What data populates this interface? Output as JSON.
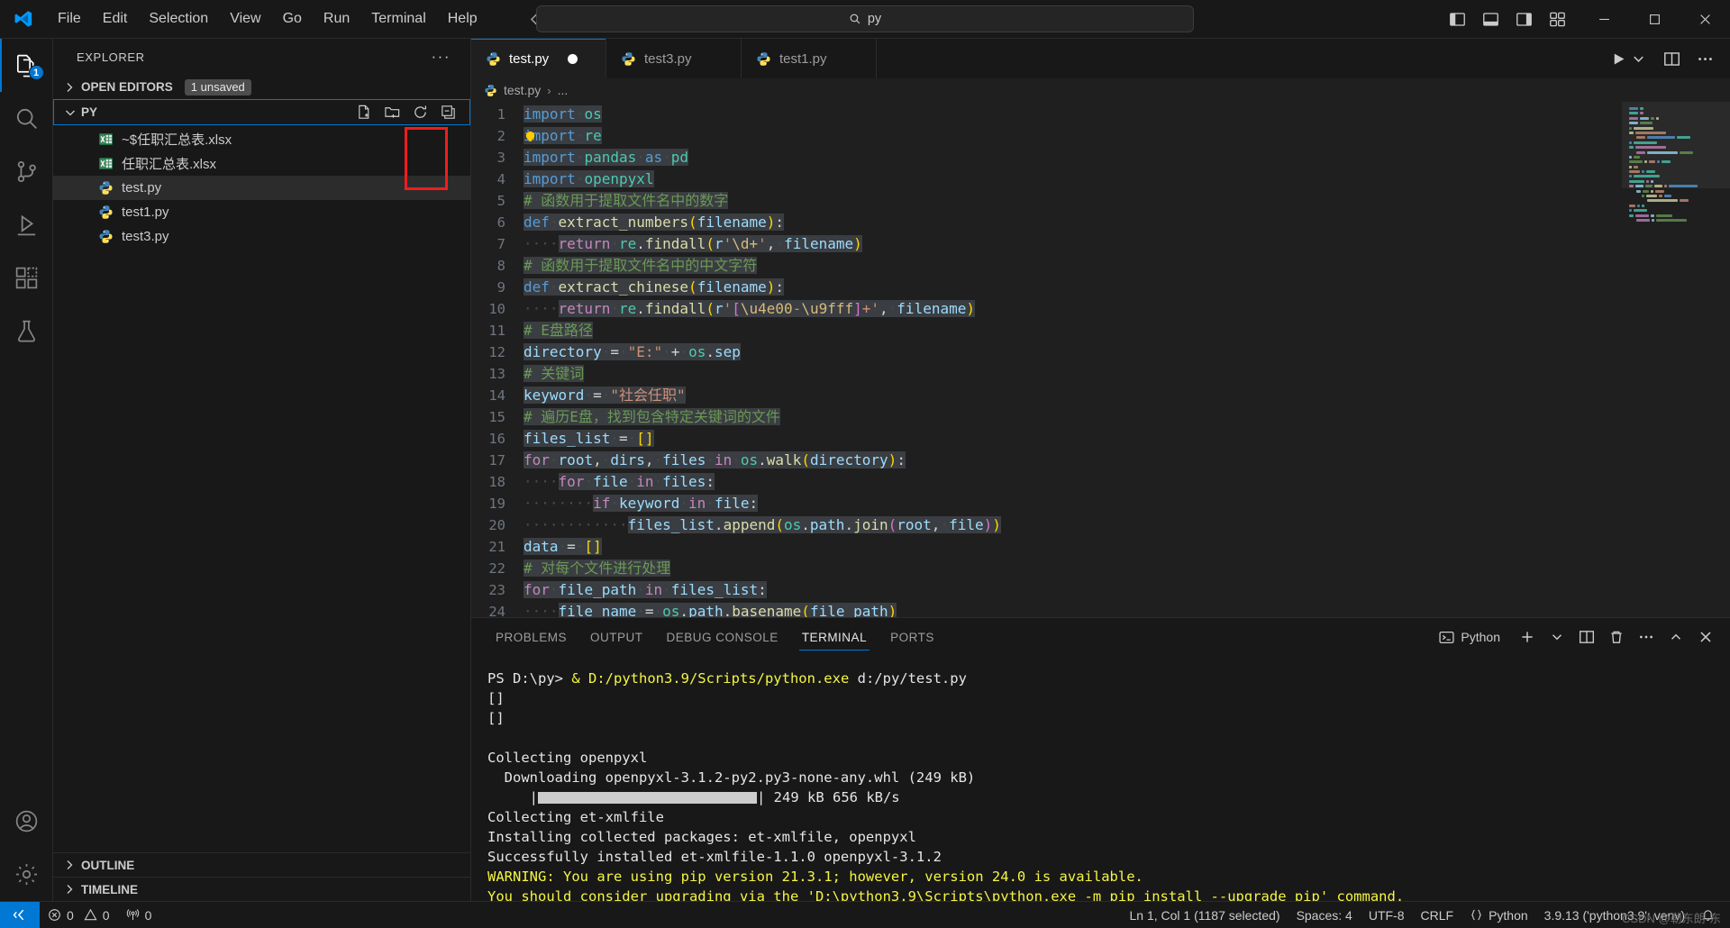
{
  "titlebar": {
    "logo_icon": "vscode-logo",
    "menus": [
      "File",
      "Edit",
      "Selection",
      "View",
      "Go",
      "Run",
      "Terminal",
      "Help"
    ],
    "command_center": {
      "icon": "search-icon",
      "text": "py"
    },
    "layout_icons": [
      "toggle-primary-sidebar-icon",
      "toggle-panel-icon",
      "toggle-secondary-sidebar-icon",
      "customize-layout-icon"
    ],
    "window_controls": [
      "minimize-button",
      "maximize-button",
      "close-button"
    ]
  },
  "activitybar": {
    "items": [
      {
        "name": "explorer",
        "icon": "files-icon",
        "badge": "1",
        "active": true
      },
      {
        "name": "search",
        "icon": "search-icon",
        "badge": "",
        "active": false
      },
      {
        "name": "source-control",
        "icon": "source-control-icon",
        "badge": "",
        "active": false
      },
      {
        "name": "run-and-debug",
        "icon": "debug-icon",
        "badge": "",
        "active": false
      },
      {
        "name": "extensions",
        "icon": "extensions-icon",
        "badge": "",
        "active": false
      },
      {
        "name": "testing",
        "icon": "beaker-icon",
        "badge": "",
        "active": false
      }
    ],
    "bottom": [
      {
        "name": "accounts",
        "icon": "account-icon"
      },
      {
        "name": "manage",
        "icon": "gear-icon"
      }
    ]
  },
  "sidebar": {
    "title": "EXPLORER",
    "more_actions": "···",
    "open_editors": {
      "label": "OPEN EDITORS",
      "badge": "1 unsaved",
      "collapsed": true
    },
    "folder": {
      "label": "PY",
      "expanded": true,
      "actions": [
        "new-file-icon",
        "new-folder-icon",
        "refresh-explorer-icon",
        "collapse-folders-icon"
      ]
    },
    "files": [
      {
        "name": "~$任职汇总表.xlsx",
        "icon": "excel-icon",
        "selected": false
      },
      {
        "name": "任职汇总表.xlsx",
        "icon": "excel-icon",
        "selected": false
      },
      {
        "name": "test.py",
        "icon": "python-icon",
        "selected": true
      },
      {
        "name": "test1.py",
        "icon": "python-icon",
        "selected": false
      },
      {
        "name": "test3.py",
        "icon": "python-icon",
        "selected": false
      }
    ],
    "bottom_sections": [
      {
        "label": "OUTLINE"
      },
      {
        "label": "TIMELINE"
      }
    ],
    "annotation": {
      "color": "#f01d1d",
      "target": "new-file-icon"
    }
  },
  "editor": {
    "tabs": [
      {
        "label": "test.py",
        "icon": "python-icon",
        "active": true,
        "dirty": true
      },
      {
        "label": "test3.py",
        "icon": "python-icon",
        "active": false,
        "dirty": false
      },
      {
        "label": "test1.py",
        "icon": "python-icon",
        "active": false,
        "dirty": false
      }
    ],
    "actions": [
      "run-python-file-icon",
      "run-dropdown-icon",
      "split-editor-icon",
      "more-actions-icon"
    ],
    "breadcrumb": {
      "icon": "python-icon",
      "file": "test.py",
      "separator": "›",
      "rest": "..."
    },
    "lines": [
      {
        "n": 1,
        "text": "import os"
      },
      {
        "n": 2,
        "text": "import re"
      },
      {
        "n": 3,
        "text": "import pandas as pd"
      },
      {
        "n": 4,
        "text": "import openpyxl"
      },
      {
        "n": 5,
        "text": "# 函数用于提取文件名中的数字"
      },
      {
        "n": 6,
        "text": "def extract_numbers(filename):"
      },
      {
        "n": 7,
        "text": "    return re.findall(r'\\d+', filename)"
      },
      {
        "n": 8,
        "text": "# 函数用于提取文件名中的中文字符"
      },
      {
        "n": 9,
        "text": "def extract_chinese(filename):"
      },
      {
        "n": 10,
        "text": "    return re.findall(r'[\\u4e00-\\u9fff]+', filename)"
      },
      {
        "n": 11,
        "text": "# E盘路径"
      },
      {
        "n": 12,
        "text": "directory = \"E:\" + os.sep"
      },
      {
        "n": 13,
        "text": "# 关键词"
      },
      {
        "n": 14,
        "text": "keyword = \"社会任职\""
      },
      {
        "n": 15,
        "text": "# 遍历E盘，找到包含特定关键词的文件"
      },
      {
        "n": 16,
        "text": "files_list = []"
      },
      {
        "n": 17,
        "text": "for root, dirs, files in os.walk(directory):"
      },
      {
        "n": 18,
        "text": "    for file in files:"
      },
      {
        "n": 19,
        "text": "        if keyword in file:"
      },
      {
        "n": 20,
        "text": "            files_list.append(os.path.join(root, file))"
      },
      {
        "n": 21,
        "text": "data = []"
      },
      {
        "n": 22,
        "text": "# 对每个文件进行处理"
      },
      {
        "n": 23,
        "text": "for file_path in files_list:"
      },
      {
        "n": 24,
        "text": "    file_name = os.path.basename(file_path)"
      }
    ],
    "lightbulb_line": 2
  },
  "panel": {
    "tabs": [
      {
        "label": "PROBLEMS",
        "active": false
      },
      {
        "label": "OUTPUT",
        "active": false
      },
      {
        "label": "DEBUG CONSOLE",
        "active": false
      },
      {
        "label": "TERMINAL",
        "active": true
      },
      {
        "label": "PORTS",
        "active": false
      }
    ],
    "terminal_selector": {
      "icon": "terminal-icon",
      "label": "Python"
    },
    "actions": [
      "new-terminal-icon",
      "terminal-dropdown-icon",
      "split-terminal-icon",
      "kill-terminal-icon",
      "more-actions-icon",
      "maximize-panel-icon",
      "close-panel-icon"
    ],
    "terminal_lines": [
      {
        "segments": [
          {
            "t": "PS D:\\py> ",
            "c": "white"
          },
          {
            "t": "& ",
            "c": "yellow"
          },
          {
            "t": "D:/python3.9/Scripts/python.exe",
            "c": "yellow"
          },
          {
            "t": " d:/py/test.py",
            "c": "white"
          }
        ]
      },
      {
        "segments": [
          {
            "t": "[]",
            "c": "white"
          }
        ]
      },
      {
        "segments": [
          {
            "t": "[]",
            "c": "white"
          }
        ]
      },
      {
        "segments": [
          {
            "t": "",
            "c": "white"
          }
        ]
      },
      {
        "segments": [
          {
            "t": "Collecting openpyxl",
            "c": "white"
          }
        ]
      },
      {
        "segments": [
          {
            "t": "  Downloading openpyxl-3.1.2-py2.py3-none-any.whl (249 kB)",
            "c": "white"
          }
        ]
      },
      {
        "progress": true,
        "prefix": "     |",
        "suffix": "| 249 kB 656 kB/s"
      },
      {
        "segments": [
          {
            "t": "Collecting et-xmlfile",
            "c": "white"
          }
        ]
      },
      {
        "segments": [
          {
            "t": "Installing collected packages: et-xmlfile, openpyxl",
            "c": "white"
          }
        ]
      },
      {
        "segments": [
          {
            "t": "Successfully installed et-xmlfile-1.1.0 openpyxl-3.1.2",
            "c": "white"
          }
        ]
      },
      {
        "segments": [
          {
            "t": "WARNING: You are using pip version 21.3.1; however, version 24.0 is available.",
            "c": "yellow"
          }
        ]
      },
      {
        "segments": [
          {
            "t": "You should consider upgrading via the 'D:\\python3.9\\Scripts\\python.exe -m pip install --upgrade pip' command.",
            "c": "yellow"
          }
        ]
      }
    ]
  },
  "statusbar": {
    "remote_icon": "remote-window-icon",
    "left": [
      {
        "icon": "error-icon",
        "label": "0"
      },
      {
        "icon": "warning-icon",
        "label": "0"
      },
      {
        "icon": "radio-tower-icon",
        "label": "0"
      }
    ],
    "right": [
      {
        "label": "Ln 1, Col 1 (1187 selected)"
      },
      {
        "label": "Spaces: 4"
      },
      {
        "label": "UTF-8"
      },
      {
        "label": "CRLF"
      },
      {
        "label": "Python",
        "icon": "braces-icon"
      },
      {
        "label": "3.9.13 ('python3.9': venv)"
      },
      {
        "icon": "bell-icon",
        "label": ""
      }
    ],
    "watermark": "CSDN @勒东朗·东"
  },
  "colors": {
    "accent": "#0078d4",
    "annotation_red": "#f01d1d",
    "bg": "#1f1f1f",
    "chrome": "#181818",
    "selection": "#3a3d41"
  }
}
